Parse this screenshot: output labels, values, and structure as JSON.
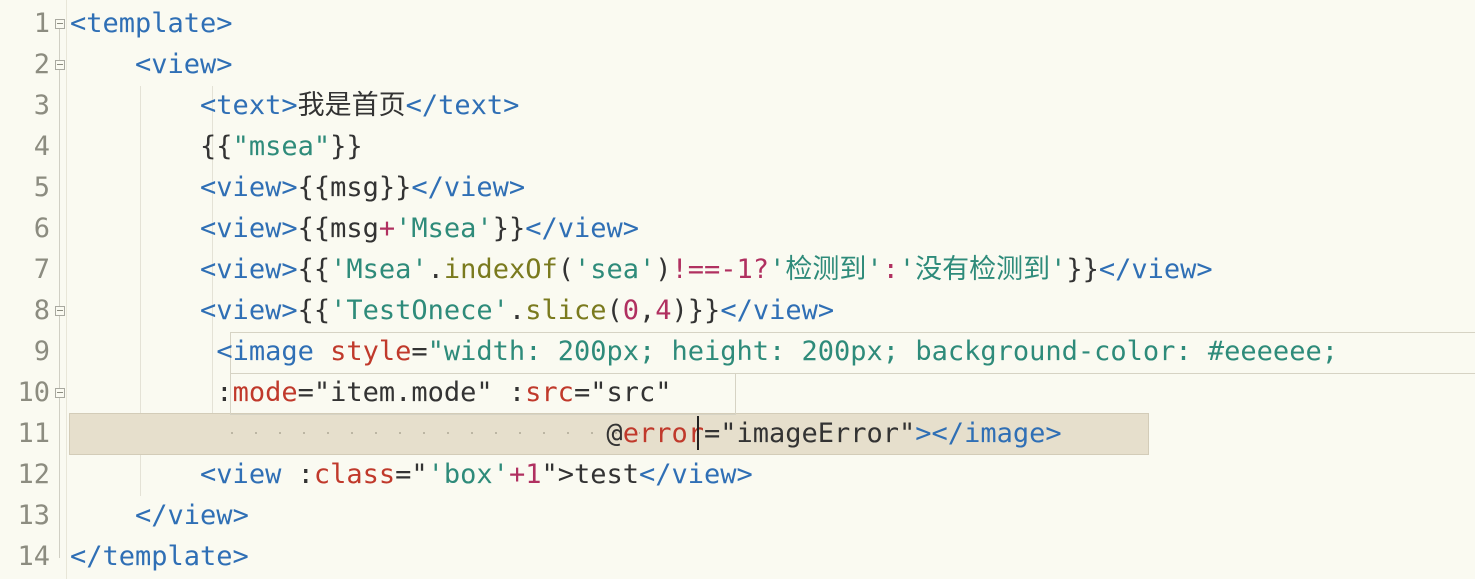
{
  "editor": {
    "line_numbers": [
      "1",
      "2",
      "3",
      "4",
      "5",
      "6",
      "7",
      "8",
      "9",
      "10",
      "11",
      "12",
      "13",
      "14"
    ],
    "lines": [
      {
        "tokens": [
          {
            "t": "tag",
            "v": "<template>"
          }
        ]
      },
      {
        "tokens": [
          {
            "t": "plain",
            "v": "    "
          },
          {
            "t": "tag",
            "v": "<view>"
          }
        ]
      },
      {
        "tokens": [
          {
            "t": "plain",
            "v": "        "
          },
          {
            "t": "tag",
            "v": "<text>"
          },
          {
            "t": "plain",
            "v": "我是首页"
          },
          {
            "t": "tag",
            "v": "</text>"
          }
        ]
      },
      {
        "tokens": [
          {
            "t": "plain",
            "v": "        {{"
          },
          {
            "t": "str",
            "v": "\"msea\""
          },
          {
            "t": "plain",
            "v": "}}"
          }
        ]
      },
      {
        "tokens": [
          {
            "t": "plain",
            "v": "        "
          },
          {
            "t": "tag",
            "v": "<view>"
          },
          {
            "t": "plain",
            "v": "{{msg}}"
          },
          {
            "t": "tag",
            "v": "</view>"
          }
        ]
      },
      {
        "tokens": [
          {
            "t": "plain",
            "v": "        "
          },
          {
            "t": "tag",
            "v": "<view>"
          },
          {
            "t": "plain",
            "v": "{{msg"
          },
          {
            "t": "op",
            "v": "+"
          },
          {
            "t": "str",
            "v": "'Msea'"
          },
          {
            "t": "plain",
            "v": "}}"
          },
          {
            "t": "tag",
            "v": "</view>"
          }
        ]
      },
      {
        "tokens": [
          {
            "t": "plain",
            "v": "        "
          },
          {
            "t": "tag",
            "v": "<view>"
          },
          {
            "t": "plain",
            "v": "{{"
          },
          {
            "t": "str",
            "v": "'Msea'"
          },
          {
            "t": "plain",
            "v": "."
          },
          {
            "t": "fn",
            "v": "indexOf"
          },
          {
            "t": "plain",
            "v": "("
          },
          {
            "t": "str",
            "v": "'sea'"
          },
          {
            "t": "plain",
            "v": ")"
          },
          {
            "t": "op",
            "v": "!==-1?"
          },
          {
            "t": "str",
            "v": "'检测到'"
          },
          {
            "t": "op",
            "v": ":"
          },
          {
            "t": "str",
            "v": "'没有检测到'"
          },
          {
            "t": "plain",
            "v": "}}"
          },
          {
            "t": "tag",
            "v": "</view>"
          }
        ]
      },
      {
        "tokens": [
          {
            "t": "plain",
            "v": "        "
          },
          {
            "t": "tag",
            "v": "<view>"
          },
          {
            "t": "plain",
            "v": "{{"
          },
          {
            "t": "str",
            "v": "'TestOnece'"
          },
          {
            "t": "plain",
            "v": "."
          },
          {
            "t": "fn",
            "v": "slice"
          },
          {
            "t": "plain",
            "v": "("
          },
          {
            "t": "num",
            "v": "0"
          },
          {
            "t": "plain",
            "v": ","
          },
          {
            "t": "num",
            "v": "4"
          },
          {
            "t": "plain",
            "v": ")}}"
          },
          {
            "t": "tag",
            "v": "</view>"
          }
        ]
      },
      {
        "tokens": [
          {
            "t": "plain",
            "v": "         "
          },
          {
            "t": "tag",
            "v": "<image "
          },
          {
            "t": "attr",
            "v": "style"
          },
          {
            "t": "plain",
            "v": "="
          },
          {
            "t": "str",
            "v": "\"width: 200px; height: 200px; background-color: #eeeeee;"
          }
        ]
      },
      {
        "tokens": [
          {
            "t": "plain",
            "v": "         :"
          },
          {
            "t": "attr",
            "v": "mode"
          },
          {
            "t": "plain",
            "v": "=\"item.mode\" :"
          },
          {
            "t": "attr",
            "v": "src"
          },
          {
            "t": "plain",
            "v": "=\"src\""
          }
        ]
      },
      {
        "tokens": [
          {
            "t": "plain",
            "v": "                                 @"
          },
          {
            "t": "attr",
            "v": "error"
          },
          {
            "t": "plain",
            "v": "=\"imageError\""
          },
          {
            "t": "tag",
            "v": "></image>"
          }
        ]
      },
      {
        "tokens": [
          {
            "t": "plain",
            "v": "        "
          },
          {
            "t": "tag",
            "v": "<view "
          },
          {
            "t": "plain",
            "v": ":"
          },
          {
            "t": "attr",
            "v": "class"
          },
          {
            "t": "plain",
            "v": "=\""
          },
          {
            "t": "str",
            "v": "'box'"
          },
          {
            "t": "op",
            "v": "+1"
          },
          {
            "t": "plain",
            "v": "\">test"
          },
          {
            "t": "tag",
            "v": "</view>"
          }
        ]
      },
      {
        "tokens": [
          {
            "t": "plain",
            "v": "    "
          },
          {
            "t": "tag",
            "v": "</view>"
          }
        ]
      },
      {
        "tokens": [
          {
            "t": "tag",
            "v": "</template>"
          }
        ]
      }
    ]
  }
}
